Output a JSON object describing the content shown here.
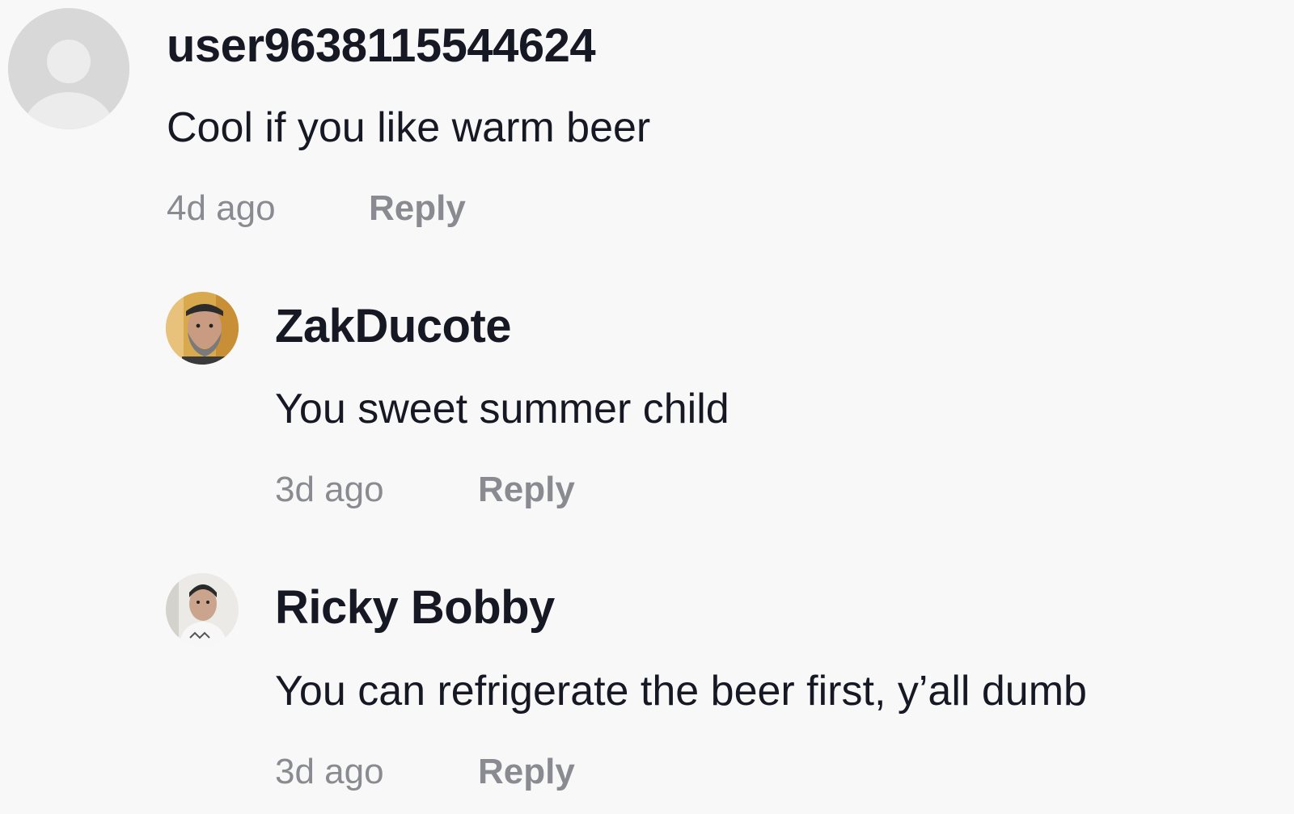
{
  "comments": [
    {
      "username": "user9638115544624",
      "text": "Cool if you like warm beer",
      "time": "4d ago",
      "reply_label": "Reply",
      "avatar_icon": "default-user-icon"
    },
    {
      "username": "ZakDucote",
      "text": "You sweet summer child",
      "time": "3d ago",
      "reply_label": "Reply",
      "avatar_icon": "user-photo"
    },
    {
      "username": "Ricky Bobby",
      "text": "You can refrigerate the beer first, y’all dumb",
      "time": "3d ago",
      "reply_label": "Reply",
      "avatar_icon": "user-photo"
    }
  ],
  "colors": {
    "background": "#f8f8f8",
    "primary_text": "#161823",
    "secondary_text": "#8a8b91",
    "default_avatar": "#d8d8d8"
  }
}
